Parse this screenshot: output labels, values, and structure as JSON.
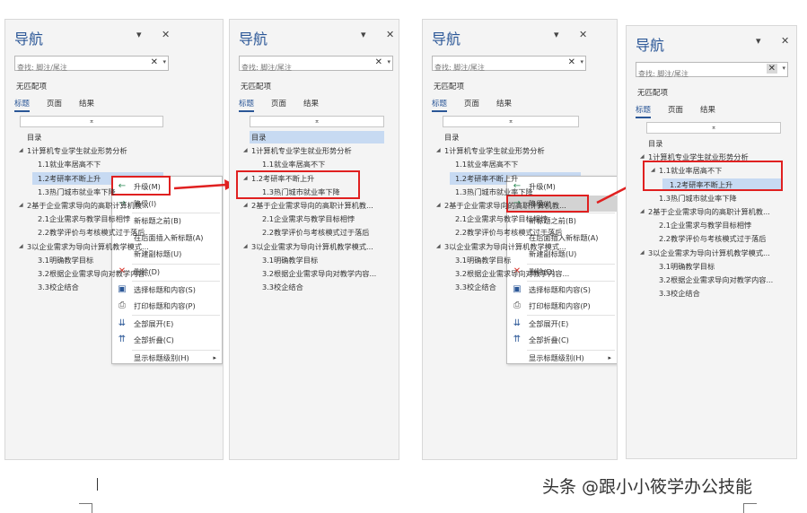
{
  "common": {
    "title": "导航",
    "search_placeholder": "查找: 脚注/尾注",
    "no_match": "无匹配项",
    "tabs": [
      "标题",
      "页面",
      "结果"
    ],
    "collapse_glyph": "⌅",
    "dropdown_glyph": "▾",
    "close_glyph": "✕",
    "clear_glyph": "✕"
  },
  "tree_before": [
    {
      "text": "目录",
      "level": 0,
      "tri": ""
    },
    {
      "text": "1计算机专业学生就业形势分析",
      "level": 0,
      "tri": "◢"
    },
    {
      "text": "1.1就业率居高不下",
      "level": 1,
      "tri": ""
    },
    {
      "text": "1.2考研率不断上升",
      "level": 1,
      "tri": ""
    },
    {
      "text": "1.3热门城市就业率下降",
      "level": 1,
      "tri": ""
    },
    {
      "text": "2基于企业需求导向的高职计算机教...",
      "level": 0,
      "tri": "◢"
    },
    {
      "text": "2.1企业需求与教学目标相悖",
      "level": 1,
      "tri": ""
    },
    {
      "text": "2.2教学评价与考核模式过于落后",
      "level": 1,
      "tri": ""
    },
    {
      "text": "3以企业需求为导向计算机教学模式...",
      "level": 0,
      "tri": "◢"
    },
    {
      "text": "3.1明确教学目标",
      "level": 1,
      "tri": ""
    },
    {
      "text": "3.2根据企业需求导向对教学内容...",
      "level": 1,
      "tri": ""
    },
    {
      "text": "3.3校企结合",
      "level": 1,
      "tri": ""
    }
  ],
  "tree_promoted": [
    {
      "text": "目录",
      "level": 0,
      "tri": ""
    },
    {
      "text": "1计算机专业学生就业形势分析",
      "level": 0,
      "tri": "◢"
    },
    {
      "text": "1.1就业率居高不下",
      "level": 1,
      "tri": ""
    },
    {
      "text": "1.2考研率不断上升",
      "level": 0,
      "tri": "◢"
    },
    {
      "text": "1.3热门城市就业率下降",
      "level": 1,
      "tri": ""
    },
    {
      "text": "2基于企业需求导向的高职计算机教...",
      "level": 0,
      "tri": "◢"
    },
    {
      "text": "2.1企业需求与教学目标相悖",
      "level": 1,
      "tri": ""
    },
    {
      "text": "2.2教学评价与考核模式过于落后",
      "level": 1,
      "tri": ""
    },
    {
      "text": "3以企业需求为导向计算机教学模式...",
      "level": 0,
      "tri": "◢"
    },
    {
      "text": "3.1明确教学目标",
      "level": 1,
      "tri": ""
    },
    {
      "text": "3.2根据企业需求导向对教学内容...",
      "level": 1,
      "tri": ""
    },
    {
      "text": "3.3校企结合",
      "level": 1,
      "tri": ""
    }
  ],
  "tree_demoted": [
    {
      "text": "目录",
      "level": 0,
      "tri": ""
    },
    {
      "text": "1计算机专业学生就业形势分析",
      "level": 0,
      "tri": "◢"
    },
    {
      "text": "1.1就业率居高不下",
      "level": 1,
      "tri": "◢"
    },
    {
      "text": "1.2考研率不断上升",
      "level": 2,
      "tri": ""
    },
    {
      "text": "1.3热门城市就业率下降",
      "level": 1,
      "tri": ""
    },
    {
      "text": "2基于企业需求导向的高职计算机教...",
      "level": 0,
      "tri": "◢"
    },
    {
      "text": "2.1企业需求与教学目标相悖",
      "level": 1,
      "tri": ""
    },
    {
      "text": "2.2教学评价与考核模式过于落后",
      "level": 1,
      "tri": ""
    },
    {
      "text": "3以企业需求为导向计算机教学模式...",
      "level": 0,
      "tri": "◢"
    },
    {
      "text": "3.1明确教学目标",
      "level": 1,
      "tri": ""
    },
    {
      "text": "3.2根据企业需求导向对教学内容...",
      "level": 1,
      "tri": ""
    },
    {
      "text": "3.3校企结合",
      "level": 1,
      "tri": ""
    }
  ],
  "menu": {
    "items": [
      {
        "label": "升级(M)",
        "icon": "arrow-left-icon",
        "glyph": "←",
        "color": "#2e8b57"
      },
      {
        "label": "降级(I)",
        "icon": "arrow-right-icon",
        "glyph": "→",
        "color": "#2e8b57"
      },
      {
        "label": "新标题之前(B)",
        "icon": "",
        "glyph": "",
        "color": "#333"
      },
      {
        "label": "在后面插入新标题(A)",
        "icon": "",
        "glyph": "",
        "color": "#333"
      },
      {
        "label": "新建副标题(U)",
        "icon": "",
        "glyph": "",
        "color": "#333"
      },
      {
        "label": "删除(D)",
        "icon": "delete-x-icon",
        "glyph": "✕",
        "color": "#d9342b"
      },
      {
        "label": "选择标题和内容(S)",
        "icon": "select-heading-icon",
        "glyph": "▣",
        "color": "#2b5797"
      },
      {
        "label": "打印标题和内容(P)",
        "icon": "printer-icon",
        "glyph": "⎙",
        "color": "#555"
      },
      {
        "label": "全部展开(E)",
        "icon": "expand-all-icon",
        "glyph": "⇊",
        "color": "#2b5797"
      },
      {
        "label": "全部折叠(C)",
        "icon": "collapse-all-icon",
        "glyph": "⇈",
        "color": "#2b5797"
      },
      {
        "label": "显示标题级别(H)",
        "icon": "",
        "glyph": "",
        "color": "#333"
      }
    ],
    "submenu_glyph": "▸"
  },
  "caption": "头条 @跟小小筱学办公技能",
  "colors": {
    "accent": "#2b5797",
    "highlight": "#c7daf2",
    "red": "#e02020"
  }
}
